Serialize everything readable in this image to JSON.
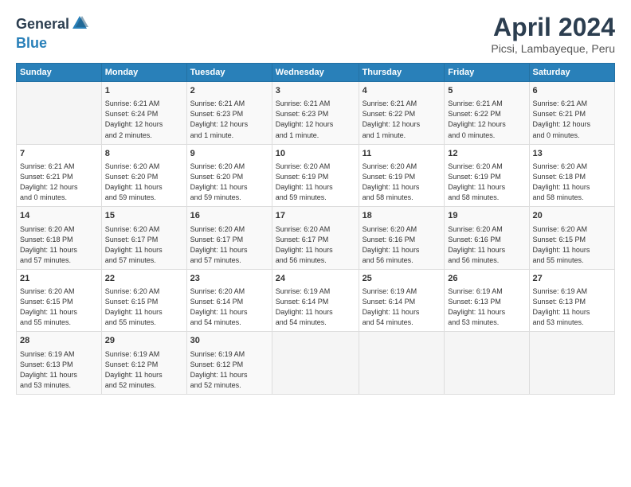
{
  "logo": {
    "general": "General",
    "blue": "Blue"
  },
  "header": {
    "month": "April 2024",
    "location": "Picsi, Lambayeque, Peru"
  },
  "weekdays": [
    "Sunday",
    "Monday",
    "Tuesday",
    "Wednesday",
    "Thursday",
    "Friday",
    "Saturday"
  ],
  "weeks": [
    [
      {
        "day": "",
        "info": ""
      },
      {
        "day": "1",
        "info": "Sunrise: 6:21 AM\nSunset: 6:24 PM\nDaylight: 12 hours\nand 2 minutes."
      },
      {
        "day": "2",
        "info": "Sunrise: 6:21 AM\nSunset: 6:23 PM\nDaylight: 12 hours\nand 1 minute."
      },
      {
        "day": "3",
        "info": "Sunrise: 6:21 AM\nSunset: 6:23 PM\nDaylight: 12 hours\nand 1 minute."
      },
      {
        "day": "4",
        "info": "Sunrise: 6:21 AM\nSunset: 6:22 PM\nDaylight: 12 hours\nand 1 minute."
      },
      {
        "day": "5",
        "info": "Sunrise: 6:21 AM\nSunset: 6:22 PM\nDaylight: 12 hours\nand 0 minutes."
      },
      {
        "day": "6",
        "info": "Sunrise: 6:21 AM\nSunset: 6:21 PM\nDaylight: 12 hours\nand 0 minutes."
      }
    ],
    [
      {
        "day": "7",
        "info": "Sunrise: 6:21 AM\nSunset: 6:21 PM\nDaylight: 12 hours\nand 0 minutes."
      },
      {
        "day": "8",
        "info": "Sunrise: 6:20 AM\nSunset: 6:20 PM\nDaylight: 11 hours\nand 59 minutes."
      },
      {
        "day": "9",
        "info": "Sunrise: 6:20 AM\nSunset: 6:20 PM\nDaylight: 11 hours\nand 59 minutes."
      },
      {
        "day": "10",
        "info": "Sunrise: 6:20 AM\nSunset: 6:19 PM\nDaylight: 11 hours\nand 59 minutes."
      },
      {
        "day": "11",
        "info": "Sunrise: 6:20 AM\nSunset: 6:19 PM\nDaylight: 11 hours\nand 58 minutes."
      },
      {
        "day": "12",
        "info": "Sunrise: 6:20 AM\nSunset: 6:19 PM\nDaylight: 11 hours\nand 58 minutes."
      },
      {
        "day": "13",
        "info": "Sunrise: 6:20 AM\nSunset: 6:18 PM\nDaylight: 11 hours\nand 58 minutes."
      }
    ],
    [
      {
        "day": "14",
        "info": "Sunrise: 6:20 AM\nSunset: 6:18 PM\nDaylight: 11 hours\nand 57 minutes."
      },
      {
        "day": "15",
        "info": "Sunrise: 6:20 AM\nSunset: 6:17 PM\nDaylight: 11 hours\nand 57 minutes."
      },
      {
        "day": "16",
        "info": "Sunrise: 6:20 AM\nSunset: 6:17 PM\nDaylight: 11 hours\nand 57 minutes."
      },
      {
        "day": "17",
        "info": "Sunrise: 6:20 AM\nSunset: 6:17 PM\nDaylight: 11 hours\nand 56 minutes."
      },
      {
        "day": "18",
        "info": "Sunrise: 6:20 AM\nSunset: 6:16 PM\nDaylight: 11 hours\nand 56 minutes."
      },
      {
        "day": "19",
        "info": "Sunrise: 6:20 AM\nSunset: 6:16 PM\nDaylight: 11 hours\nand 56 minutes."
      },
      {
        "day": "20",
        "info": "Sunrise: 6:20 AM\nSunset: 6:15 PM\nDaylight: 11 hours\nand 55 minutes."
      }
    ],
    [
      {
        "day": "21",
        "info": "Sunrise: 6:20 AM\nSunset: 6:15 PM\nDaylight: 11 hours\nand 55 minutes."
      },
      {
        "day": "22",
        "info": "Sunrise: 6:20 AM\nSunset: 6:15 PM\nDaylight: 11 hours\nand 55 minutes."
      },
      {
        "day": "23",
        "info": "Sunrise: 6:20 AM\nSunset: 6:14 PM\nDaylight: 11 hours\nand 54 minutes."
      },
      {
        "day": "24",
        "info": "Sunrise: 6:19 AM\nSunset: 6:14 PM\nDaylight: 11 hours\nand 54 minutes."
      },
      {
        "day": "25",
        "info": "Sunrise: 6:19 AM\nSunset: 6:14 PM\nDaylight: 11 hours\nand 54 minutes."
      },
      {
        "day": "26",
        "info": "Sunrise: 6:19 AM\nSunset: 6:13 PM\nDaylight: 11 hours\nand 53 minutes."
      },
      {
        "day": "27",
        "info": "Sunrise: 6:19 AM\nSunset: 6:13 PM\nDaylight: 11 hours\nand 53 minutes."
      }
    ],
    [
      {
        "day": "28",
        "info": "Sunrise: 6:19 AM\nSunset: 6:13 PM\nDaylight: 11 hours\nand 53 minutes."
      },
      {
        "day": "29",
        "info": "Sunrise: 6:19 AM\nSunset: 6:12 PM\nDaylight: 11 hours\nand 52 minutes."
      },
      {
        "day": "30",
        "info": "Sunrise: 6:19 AM\nSunset: 6:12 PM\nDaylight: 11 hours\nand 52 minutes."
      },
      {
        "day": "",
        "info": ""
      },
      {
        "day": "",
        "info": ""
      },
      {
        "day": "",
        "info": ""
      },
      {
        "day": "",
        "info": ""
      }
    ]
  ]
}
